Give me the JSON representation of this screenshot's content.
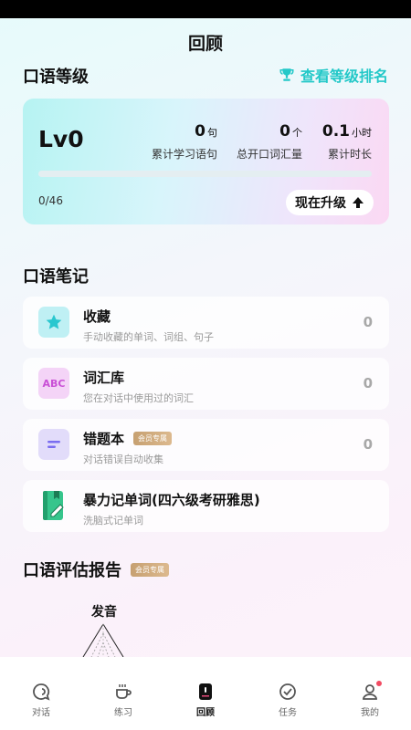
{
  "header": {
    "title": "回顾"
  },
  "level": {
    "section_title": "口语等级",
    "rank_link": "查看等级排名",
    "level_label": "Lv0",
    "stats": [
      {
        "value": "0",
        "unit": "句",
        "label": "累计学习语句"
      },
      {
        "value": "0",
        "unit": "个",
        "label": "总开口词汇量"
      },
      {
        "value": "0.1",
        "unit": "小时",
        "label": "累计时长"
      }
    ],
    "progress_text": "0/46",
    "progress_fraction": 0,
    "upgrade_label": "现在升级"
  },
  "notes": {
    "section_title": "口语笔记",
    "items": [
      {
        "title": "收藏",
        "subtitle": "手动收藏的单词、词组、句子",
        "count": "0",
        "icon": "star-icon"
      },
      {
        "title": "词汇库",
        "subtitle": "您在对话中使用过的词汇",
        "count": "0",
        "icon": "abc-icon",
        "icon_text": "ABC"
      },
      {
        "title": "错题本",
        "badge": "会员专属",
        "subtitle": "对话错误自动收集",
        "count": "0",
        "icon": "list-icon"
      },
      {
        "title": "暴力记单词(四六级考研雅思)",
        "subtitle": "洗脑式记单词",
        "icon": "notebook-icon"
      }
    ]
  },
  "report": {
    "section_title": "口语评估报告",
    "badge": "会员专属",
    "radar_label": "发音"
  },
  "tabbar": {
    "items": [
      {
        "label": "对话",
        "icon": "chat-icon"
      },
      {
        "label": "练习",
        "icon": "coffee-icon"
      },
      {
        "label": "回顾",
        "icon": "review-icon",
        "active": true
      },
      {
        "label": "任务",
        "icon": "check-circle-icon"
      },
      {
        "label": "我的",
        "icon": "profile-icon",
        "notification_dot": true
      }
    ]
  },
  "colors": {
    "accent": "#23c8c8",
    "progress": "#2bd2c6",
    "vip": "#c6a071",
    "notification": "#f24b62"
  }
}
